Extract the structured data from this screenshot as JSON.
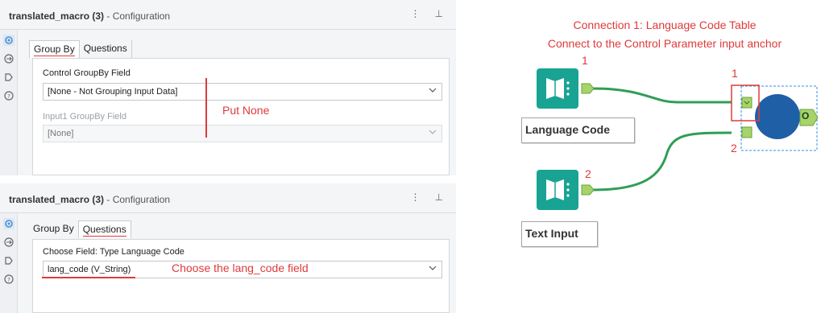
{
  "top_panel": {
    "title_bold": "translated_macro (3)",
    "title_sub": " - Configuration",
    "more_glyph": "⋮",
    "pin_glyph": "⊥",
    "tabs": [
      "Group By",
      "Questions"
    ],
    "field1_label": "Control GroupBy Field",
    "field1_value": "[None - Not Grouping Input Data]",
    "field2_label": "Input1 GroupBy Field",
    "field2_value": "[None]",
    "annotation": "Put None"
  },
  "bottom_panel": {
    "title_bold": "translated_macro (3)",
    "title_sub": " - Configuration",
    "more_glyph": "⋮",
    "pin_glyph": "⊥",
    "tabs": [
      "Group By",
      "Questions"
    ],
    "field_label": "Choose Field: Type Language Code",
    "field_value": "lang_code (V_String)",
    "annotation": "Choose the lang_code field"
  },
  "canvas": {
    "title_line1": "Connection 1: Language Code Table",
    "title_line2": "Connect to the Control Parameter input anchor",
    "node1_label": "Language Code",
    "node2_label": "Text Input",
    "node1_number": "1",
    "node2_number": "2",
    "macro_anchor1_number": "1",
    "macro_anchor2_number": "2",
    "output_anchor": "O"
  },
  "icons": [
    "settings-icon",
    "connection-icon",
    "tag-icon",
    "help-icon",
    "book-icon",
    "chevron-down-icon",
    "more-icon",
    "pin-icon"
  ],
  "colors": {
    "annotation_red": "#e03a3a",
    "node_teal": "#19a393",
    "connector_green": "#2f9e55",
    "anchor_green": "#a6d46a",
    "macro_blue": "#1f5fa6",
    "selection_blue": "#3a8ee6"
  }
}
